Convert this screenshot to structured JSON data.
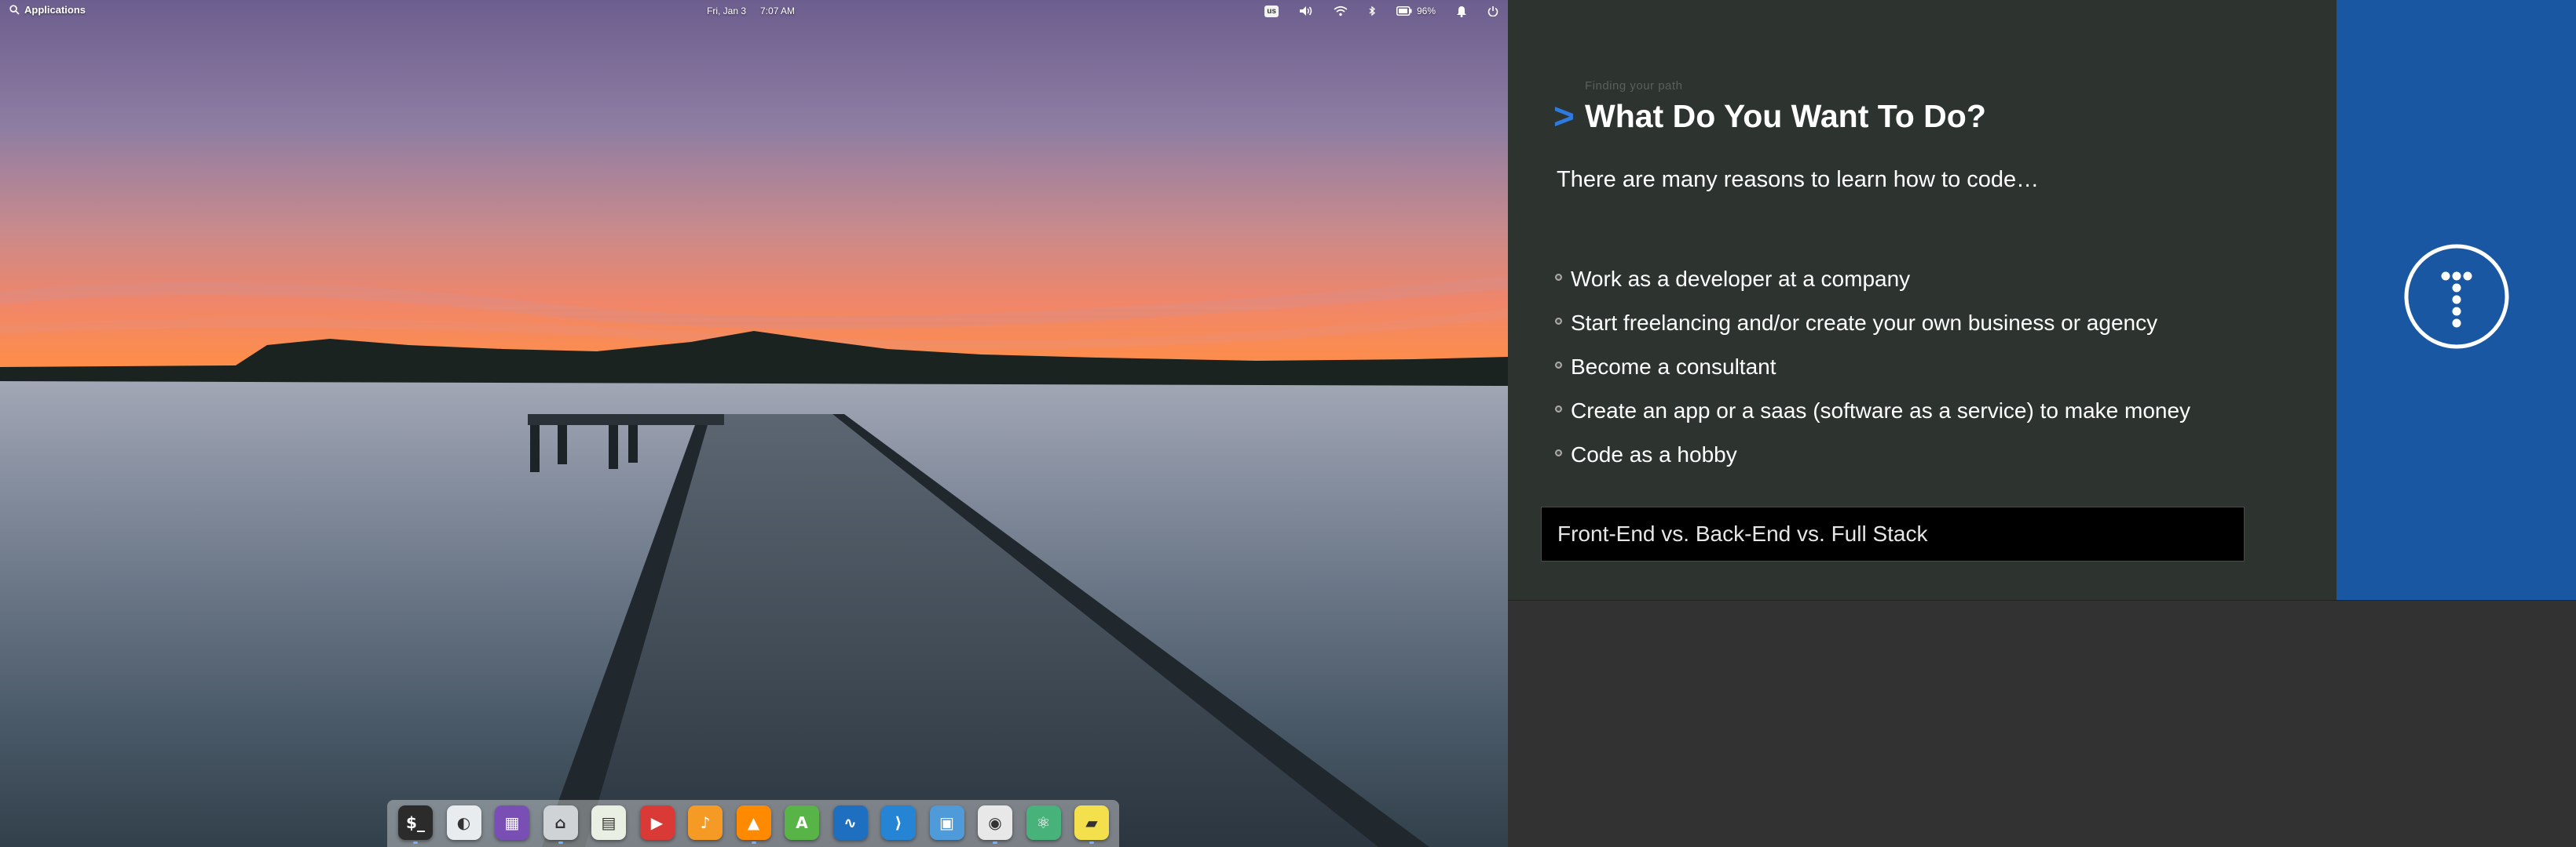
{
  "top_panel": {
    "applications_label": "Applications",
    "date": "Fri, Jan 3",
    "time": "7:07 AM",
    "keyboard_layout": "us",
    "battery_percent": "96%"
  },
  "dock": {
    "apps": [
      {
        "name": "terminal-icon",
        "color": "#2b2b2b"
      },
      {
        "name": "settings-toggle-icon",
        "color": "#e8ecef"
      },
      {
        "name": "appcenter-icon",
        "color": "#7a4fb5"
      },
      {
        "name": "files-icon",
        "color": "#cfd3d6"
      },
      {
        "name": "spreadsheet-icon",
        "color": "#e9efe3"
      },
      {
        "name": "videos-icon",
        "color": "#d93a36"
      },
      {
        "name": "music-icon",
        "color": "#f59a25"
      },
      {
        "name": "vlc-icon",
        "color": "#ff8a00"
      },
      {
        "name": "android-studio-icon",
        "color": "#58b447"
      },
      {
        "name": "system-monitor-icon",
        "color": "#1f6fc1"
      },
      {
        "name": "vscode-icon",
        "color": "#2584d4"
      },
      {
        "name": "photos-icon",
        "color": "#4f9bd9"
      },
      {
        "name": "chrome-icon",
        "color": "#e8e8e8"
      },
      {
        "name": "atom-icon",
        "color": "#48b27b"
      },
      {
        "name": "sticky-notes-icon",
        "color": "#f4e04d"
      }
    ]
  },
  "slide": {
    "subtitle": "Finding your path",
    "chevron": ">",
    "title": "What Do You Want To Do?",
    "intro": "There are many reasons to learn how to code…",
    "bullets": [
      "Work as a developer at a company",
      "Start freelancing and/or create your own business or agency",
      "Become a consultant",
      "Create an app or a saas (software as a service) to make money",
      "Code as a hobby"
    ],
    "banner": "Front-End vs. Back-End vs. Full Stack",
    "colors": {
      "background": "#2d3430",
      "accent": "#2f7ae0",
      "sidebar": "#1a57a3"
    }
  }
}
